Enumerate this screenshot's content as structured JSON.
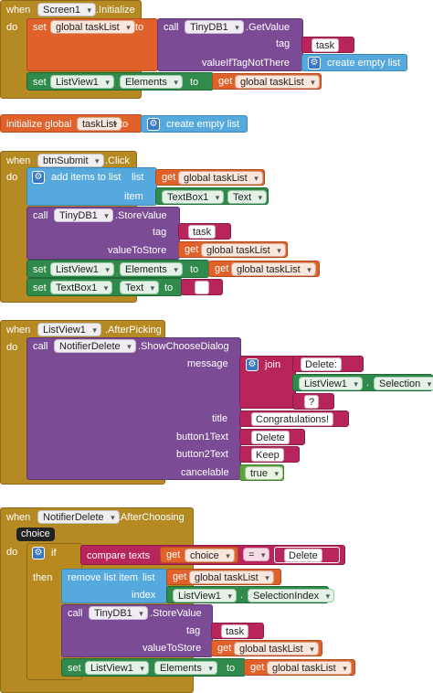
{
  "common": {
    "when": "when",
    "do": "do",
    "set": "set",
    "to": "to",
    "call": "call",
    "get": "get",
    "initialize_global": "initialize global",
    "tag": "tag",
    "value_if_tag_not_there": "valueIfTagNotThere",
    "value_to_store": "valueToStore",
    "create_empty_list": "create empty list",
    "quote_open": "\"",
    "quote_close": "\""
  },
  "block1": {
    "component": "Screen1",
    "event": ".Initialize",
    "global_var": "global taskList",
    "db": "TinyDB1",
    "method": ".GetValue",
    "tag_value": "task",
    "listview": "ListView1",
    "property": "Elements",
    "get_var": "global taskList"
  },
  "block2": {
    "name": "taskList"
  },
  "block3": {
    "component": "btnSubmit",
    "event": ".Click",
    "add_items": "add items to list",
    "list": "list",
    "item": "item",
    "get_var": "global taskList",
    "textbox": "TextBox1",
    "text_prop": "Text",
    "db": "TinyDB1",
    "method": ".StoreValue",
    "tag_value": "task",
    "listview": "ListView1",
    "elements": "Elements",
    "empty_text": ""
  },
  "block4": {
    "component": "ListView1",
    "event": ".AfterPicking",
    "notifier": "NotifierDelete",
    "method": ".ShowChooseDialog",
    "message": "message",
    "join": "join",
    "delete_str": "Delete: ",
    "selection": "Selection",
    "qmark": "?",
    "title": "title",
    "title_value": "Congratulations!",
    "button1": "button1Text",
    "button1_value": "Delete",
    "button2": "button2Text",
    "button2_value": "Keep",
    "cancelable": "cancelable",
    "cancelable_value": "true"
  },
  "block5": {
    "component": "NotifierDelete",
    "event": ".AfterChoosing",
    "param": "choice",
    "if": "if",
    "then": "then",
    "compare": "compare texts",
    "get_choice": "choice",
    "op": "=",
    "delete_str": "Delete",
    "remove_item": "remove list item",
    "list": "list",
    "index": "index",
    "get_var": "global taskList",
    "listview": "ListView1",
    "selection_index": "SelectionIndex",
    "db": "TinyDB1",
    "method": ".StoreValue",
    "tag_value": "task",
    "elements": "Elements"
  }
}
